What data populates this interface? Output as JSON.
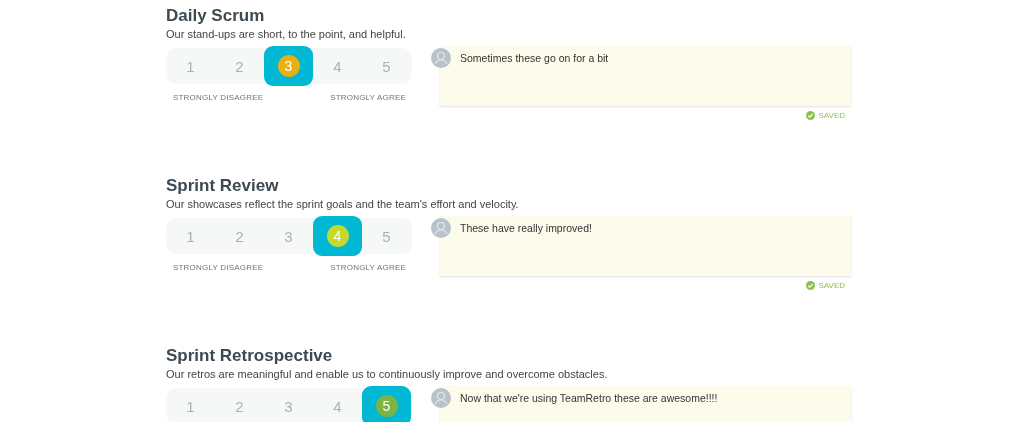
{
  "sections": [
    {
      "title": "Daily Scrum",
      "description": "Our stand-ups are short, to the point, and helpful.",
      "color": "#e8b010",
      "options": [
        {
          "label": "1",
          "selected": false
        },
        {
          "label": "2",
          "selected": false
        },
        {
          "label": "3",
          "selected": true
        },
        {
          "label": "4",
          "selected": false
        },
        {
          "label": "5",
          "selected": false
        }
      ],
      "low_label": "STRONGLY DISAGREE",
      "high_label": "STRONGLY AGREE",
      "comment": "Sometimes these go on for a bit",
      "status": "SAVED"
    },
    {
      "title": "Sprint Review",
      "description": "Our showcases reflect the sprint goals and the team's effort and velocity.",
      "color": "#c6d82c",
      "options": [
        {
          "label": "1",
          "selected": false
        },
        {
          "label": "2",
          "selected": false
        },
        {
          "label": "3",
          "selected": false
        },
        {
          "label": "4",
          "selected": true
        },
        {
          "label": "5",
          "selected": false
        }
      ],
      "low_label": "STRONGLY DISAGREE",
      "high_label": "STRONGLY AGREE",
      "comment": "These have really improved!",
      "status": "SAVED"
    },
    {
      "title": "Sprint Retrospective",
      "description": "Our retros are meaningful and enable us to continuously improve and overcome obstacles.",
      "color": "#7cb342",
      "options": [
        {
          "label": "1",
          "selected": false
        },
        {
          "label": "2",
          "selected": false
        },
        {
          "label": "3",
          "selected": false
        },
        {
          "label": "4",
          "selected": false
        },
        {
          "label": "5",
          "selected": true
        }
      ],
      "comment": "Now that we're using TeamRetro these are awesome!!!!"
    }
  ]
}
